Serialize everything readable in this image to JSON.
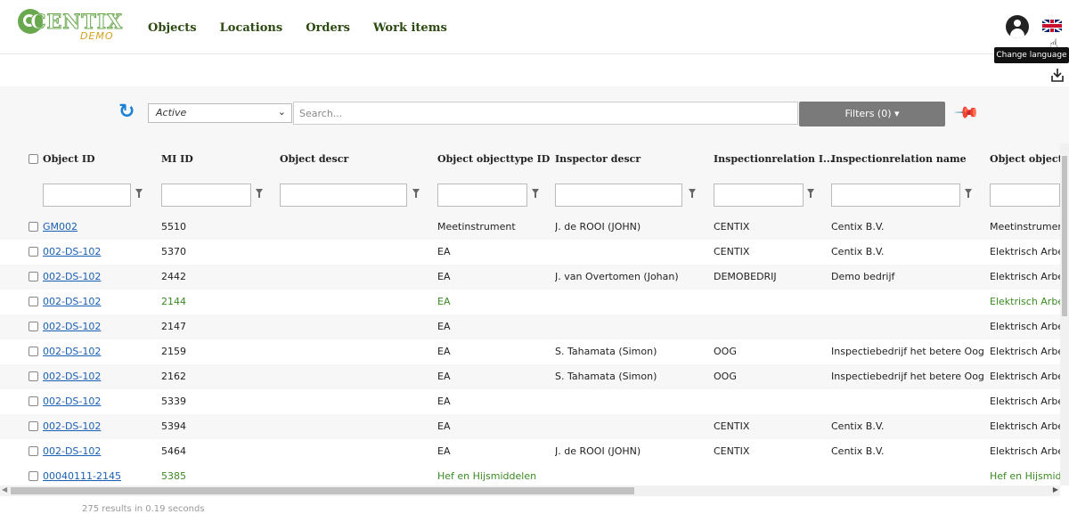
{
  "header": {
    "logo_text": "CENTIX",
    "logo_sub": "DEMO",
    "nav": [
      "Objects",
      "Locations",
      "Orders",
      "Work items"
    ],
    "tooltip": "Change language",
    "icons": [
      "user-icon",
      "uk-flag-icon",
      "download-icon",
      "pointer-cursor"
    ]
  },
  "toolbar": {
    "status_value": "Active",
    "search_placeholder": "Search...",
    "filters_label": "Filters (0)",
    "filters_caret": "▾",
    "icons": [
      "refresh-icon",
      "pin-icon"
    ]
  },
  "table": {
    "columns": [
      "Object ID",
      "MI ID",
      "Object descr",
      "Object objecttype ID",
      "Inspector descr",
      "Inspectionrelation I...",
      "Inspectionrelation name",
      "Object objectty"
    ],
    "rows": [
      {
        "object_id": "GM002",
        "mi_id": "5510",
        "descr": "",
        "objecttype_id": "Meetinstrument",
        "inspector": "J. de ROOI (JOHN)",
        "rel_id": "CENTIX",
        "rel_name": "Centix B.V.",
        "objecttype": "Meetinstrument",
        "style": "alt"
      },
      {
        "object_id": "002-DS-102",
        "mi_id": "5370",
        "descr": "",
        "objecttype_id": "EA",
        "inspector": "",
        "rel_id": "CENTIX",
        "rel_name": "Centix B.V.",
        "objecttype": "Elektrisch Arbeids",
        "style": ""
      },
      {
        "object_id": "002-DS-102",
        "mi_id": "2442",
        "descr": "",
        "objecttype_id": "EA",
        "inspector": "J. van Overtomen (Johan)",
        "rel_id": "DEMOBEDRIJ",
        "rel_name": "Demo bedrijf",
        "objecttype": "Elektrisch Arbeids",
        "style": "alt"
      },
      {
        "object_id": "002-DS-102",
        "mi_id": "2144",
        "descr": "",
        "objecttype_id": "EA",
        "inspector": "",
        "rel_id": "",
        "rel_name": "",
        "objecttype": "Elektrisch Arbeids",
        "style": "green"
      },
      {
        "object_id": "002-DS-102",
        "mi_id": "2147",
        "descr": "",
        "objecttype_id": "EA",
        "inspector": "",
        "rel_id": "",
        "rel_name": "",
        "objecttype": "Elektrisch Arbeids",
        "style": "alt"
      },
      {
        "object_id": "002-DS-102",
        "mi_id": "2159",
        "descr": "",
        "objecttype_id": "EA",
        "inspector": "S. Tahamata (Simon)",
        "rel_id": "OOG",
        "rel_name": "Inspectiebedrijf het betere Oog BV",
        "objecttype": "Elektrisch Arbeids",
        "style": ""
      },
      {
        "object_id": "002-DS-102",
        "mi_id": "2162",
        "descr": "",
        "objecttype_id": "EA",
        "inspector": "S. Tahamata (Simon)",
        "rel_id": "OOG",
        "rel_name": "Inspectiebedrijf het betere Oog BV",
        "objecttype": "Elektrisch Arbeids",
        "style": "alt"
      },
      {
        "object_id": "002-DS-102",
        "mi_id": "5339",
        "descr": "",
        "objecttype_id": "EA",
        "inspector": "",
        "rel_id": "",
        "rel_name": "",
        "objecttype": "Elektrisch Arbeids",
        "style": ""
      },
      {
        "object_id": "002-DS-102",
        "mi_id": "5394",
        "descr": "",
        "objecttype_id": "EA",
        "inspector": "",
        "rel_id": "CENTIX",
        "rel_name": "Centix B.V.",
        "objecttype": "Elektrisch Arbeids",
        "style": "alt"
      },
      {
        "object_id": "002-DS-102",
        "mi_id": "5464",
        "descr": "",
        "objecttype_id": "EA",
        "inspector": "J. de ROOI (JOHN)",
        "rel_id": "CENTIX",
        "rel_name": "Centix B.V.",
        "objecttype": "Elektrisch Arbeids",
        "style": ""
      },
      {
        "object_id": "00040111-2145",
        "mi_id": "5385",
        "descr": "",
        "objecttype_id": "Hef en Hijsmiddelen",
        "inspector": "",
        "rel_id": "",
        "rel_name": "",
        "objecttype": "Hef en Hijsmidde",
        "style": "green"
      }
    ]
  },
  "footer": {
    "results": "275 results in 0.19 seconds"
  }
}
